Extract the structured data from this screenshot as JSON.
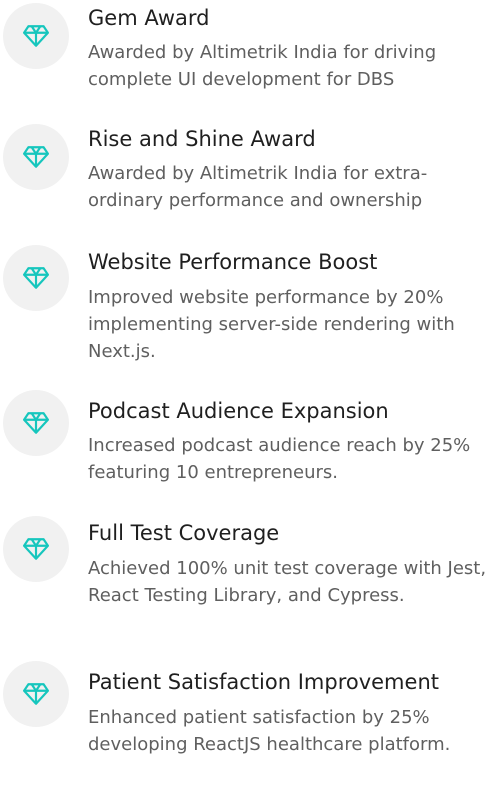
{
  "theme": {
    "icon_color": "#16c6bd",
    "icon_background": "#f1f1f1",
    "title_color": "#1f1f1f",
    "text_color": "#5f5f5f"
  },
  "awards": [
    {
      "icon": "gem-icon",
      "title": "Gem Award",
      "description": "Awarded by Altimetrik India for driving complete UI development for DBS"
    },
    {
      "icon": "gem-icon",
      "title": "Rise and Shine Award",
      "description": "Awarded by Altimetrik India for extra-ordinary performance and ownership"
    },
    {
      "icon": "gem-icon",
      "title": "Website Performance Boost",
      "description": "Improved website performance by 20% implementing server-side rendering with Next.js."
    },
    {
      "icon": "gem-icon",
      "title": "Podcast Audience Expansion",
      "description": "Increased podcast audience reach by 25% featuring 10 entrepreneurs."
    },
    {
      "icon": "gem-icon",
      "title": "Full Test Coverage",
      "description": "Achieved 100% unit test coverage with Jest, React Testing Library, and Cypress."
    },
    {
      "icon": "gem-icon",
      "title": "Patient Satisfaction Improvement",
      "description": "Enhanced patient satisfaction by 25% developing ReactJS healthcare platform."
    }
  ]
}
